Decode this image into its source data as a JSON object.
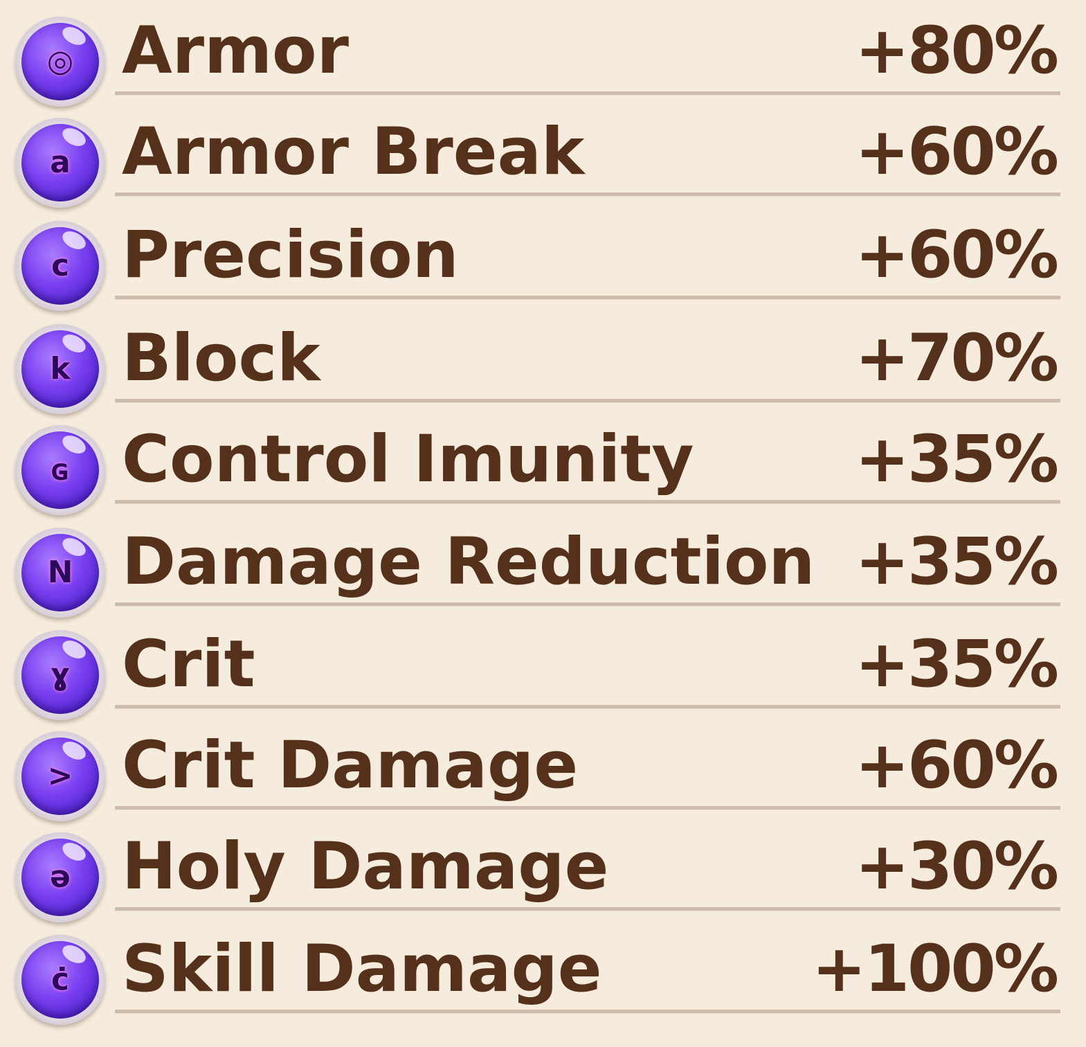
{
  "stats": [
    {
      "name": "Armor",
      "value": "+80%",
      "icon": "rune-circle-icon",
      "glyph": "◎"
    },
    {
      "name": "Armor Break",
      "value": "+60%",
      "icon": "rune-a-icon",
      "glyph": "a"
    },
    {
      "name": "Precision",
      "value": "+60%",
      "icon": "rune-c-icon",
      "glyph": "c"
    },
    {
      "name": "Block",
      "value": "+70%",
      "icon": "rune-k-icon",
      "glyph": "k"
    },
    {
      "name": "Control Imunity",
      "value": "+35%",
      "icon": "rune-square-icon",
      "glyph": "ɢ"
    },
    {
      "name": "Damage Reduction",
      "value": "+35%",
      "icon": "rune-n-icon",
      "glyph": "N"
    },
    {
      "name": "Crit",
      "value": "+35%",
      "icon": "rune-swirl-icon",
      "glyph": "ɣ"
    },
    {
      "name": "Crit Damage",
      "value": "+60%",
      "icon": "rune-arrow-icon",
      "glyph": ">"
    },
    {
      "name": "Holy Damage",
      "value": "+30%",
      "icon": "rune-spiral-icon",
      "glyph": "ə"
    },
    {
      "name": "Skill Damage",
      "value": "+100%",
      "icon": "rune-c-dot-icon",
      "glyph": "ċ"
    }
  ],
  "colors": {
    "background": "#f5ecdd",
    "text": "#55301b",
    "orb": "#7a3ff0",
    "underline": "#cdbcab"
  }
}
